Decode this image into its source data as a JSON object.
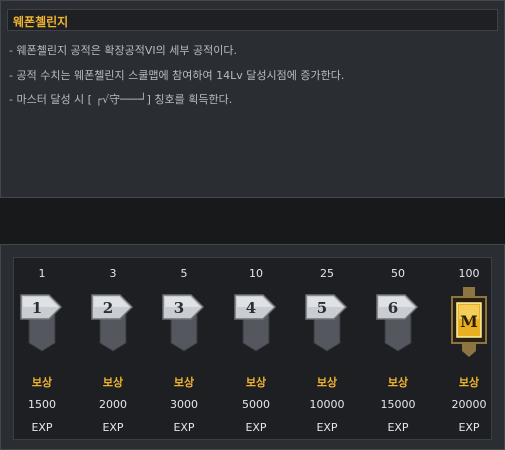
{
  "title": "웨폰첼린지",
  "description": [
    "- 웨폰첼린지 공적은 확장공적VI의 세부 공적이다.",
    "- 공적 수치는 웨폰첼린지 스쿨맵에 참여하여 14Lv 달성시점에 증가한다.",
    "- 마스터 달성 시 [ ┌√守───┘] 칭호를 획득한다."
  ],
  "tiers": [
    {
      "level": "1",
      "badge": "1",
      "reward_label": "보상",
      "reward_value": "1500",
      "reward_unit": "EXP"
    },
    {
      "level": "3",
      "badge": "2",
      "reward_label": "보상",
      "reward_value": "2000",
      "reward_unit": "EXP"
    },
    {
      "level": "5",
      "badge": "3",
      "reward_label": "보상",
      "reward_value": "3000",
      "reward_unit": "EXP"
    },
    {
      "level": "10",
      "badge": "4",
      "reward_label": "보상",
      "reward_value": "5000",
      "reward_unit": "EXP"
    },
    {
      "level": "25",
      "badge": "5",
      "reward_label": "보상",
      "reward_value": "10000",
      "reward_unit": "EXP"
    },
    {
      "level": "50",
      "badge": "6",
      "reward_label": "보상",
      "reward_value": "15000",
      "reward_unit": "EXP"
    },
    {
      "level": "100",
      "badge": "M",
      "reward_label": "보상",
      "reward_value": "20000",
      "reward_unit": "EXP"
    }
  ],
  "colors": {
    "accent": "#f0b330",
    "text": "#e4e7ea",
    "badge_silver": "#c9cdd2",
    "badge_gold": "#e8b020"
  }
}
